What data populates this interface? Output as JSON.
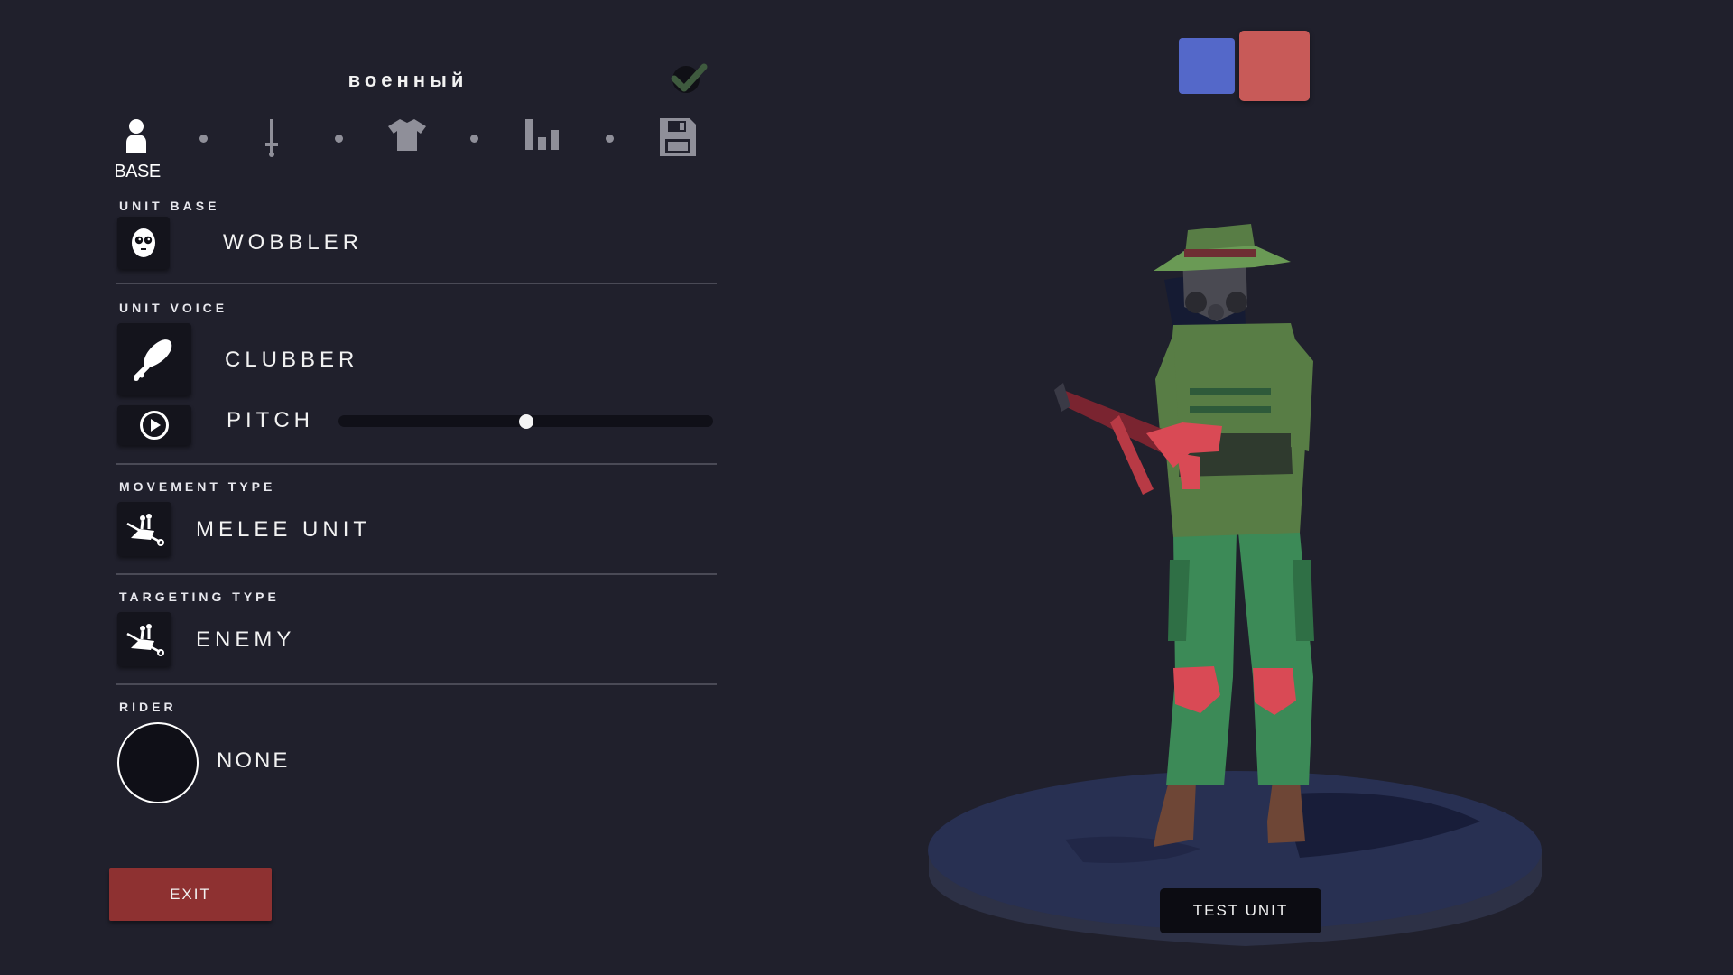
{
  "header": {
    "unit_name": "военный"
  },
  "steps": {
    "active_label": "BASE",
    "items": [
      {
        "icon": "person-icon"
      },
      {
        "icon": "sword-icon"
      },
      {
        "icon": "shirt-icon"
      },
      {
        "icon": "bar-chart-icon"
      },
      {
        "icon": "save-icon"
      }
    ]
  },
  "unit_base": {
    "label": "UNIT BASE",
    "value": "WOBBLER",
    "icon": "wobbler-face-icon"
  },
  "unit_voice": {
    "label": "UNIT VOICE",
    "value": "CLUBBER",
    "icon": "club-icon",
    "play_icon": "play-icon",
    "pitch_label": "PITCH",
    "pitch_value": 0.5
  },
  "movement_type": {
    "label": "MOVEMENT TYPE",
    "value": "MELEE UNIT",
    "icon": "unit-charge-icon"
  },
  "targeting_type": {
    "label": "TARGETING TYPE",
    "value": "ENEMY",
    "icon": "unit-charge-icon"
  },
  "rider": {
    "label": "RIDER",
    "value": "NONE"
  },
  "buttons": {
    "exit": "EXIT",
    "test_unit": "TEST UNIT"
  },
  "teams": {
    "blue_color": "#5468c9",
    "red_color": "#c85a58",
    "selected": "red"
  },
  "colors": {
    "background": "#20202c",
    "exit_button": "#8e3131",
    "confirm_check": "#3e5a3e"
  }
}
